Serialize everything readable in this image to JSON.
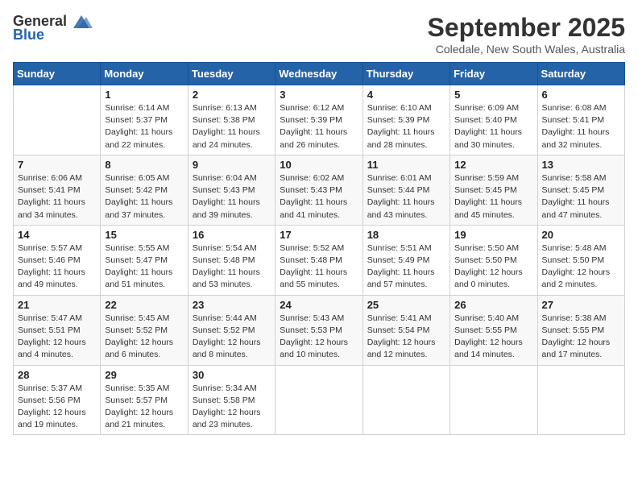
{
  "logo": {
    "general": "General",
    "blue": "Blue"
  },
  "title": "September 2025",
  "location": "Coledale, New South Wales, Australia",
  "weekdays": [
    "Sunday",
    "Monday",
    "Tuesday",
    "Wednesday",
    "Thursday",
    "Friday",
    "Saturday"
  ],
  "weeks": [
    [
      {
        "day": "",
        "info": ""
      },
      {
        "day": "1",
        "info": "Sunrise: 6:14 AM\nSunset: 5:37 PM\nDaylight: 11 hours\nand 22 minutes."
      },
      {
        "day": "2",
        "info": "Sunrise: 6:13 AM\nSunset: 5:38 PM\nDaylight: 11 hours\nand 24 minutes."
      },
      {
        "day": "3",
        "info": "Sunrise: 6:12 AM\nSunset: 5:39 PM\nDaylight: 11 hours\nand 26 minutes."
      },
      {
        "day": "4",
        "info": "Sunrise: 6:10 AM\nSunset: 5:39 PM\nDaylight: 11 hours\nand 28 minutes."
      },
      {
        "day": "5",
        "info": "Sunrise: 6:09 AM\nSunset: 5:40 PM\nDaylight: 11 hours\nand 30 minutes."
      },
      {
        "day": "6",
        "info": "Sunrise: 6:08 AM\nSunset: 5:41 PM\nDaylight: 11 hours\nand 32 minutes."
      }
    ],
    [
      {
        "day": "7",
        "info": "Sunrise: 6:06 AM\nSunset: 5:41 PM\nDaylight: 11 hours\nand 34 minutes."
      },
      {
        "day": "8",
        "info": "Sunrise: 6:05 AM\nSunset: 5:42 PM\nDaylight: 11 hours\nand 37 minutes."
      },
      {
        "day": "9",
        "info": "Sunrise: 6:04 AM\nSunset: 5:43 PM\nDaylight: 11 hours\nand 39 minutes."
      },
      {
        "day": "10",
        "info": "Sunrise: 6:02 AM\nSunset: 5:43 PM\nDaylight: 11 hours\nand 41 minutes."
      },
      {
        "day": "11",
        "info": "Sunrise: 6:01 AM\nSunset: 5:44 PM\nDaylight: 11 hours\nand 43 minutes."
      },
      {
        "day": "12",
        "info": "Sunrise: 5:59 AM\nSunset: 5:45 PM\nDaylight: 11 hours\nand 45 minutes."
      },
      {
        "day": "13",
        "info": "Sunrise: 5:58 AM\nSunset: 5:45 PM\nDaylight: 11 hours\nand 47 minutes."
      }
    ],
    [
      {
        "day": "14",
        "info": "Sunrise: 5:57 AM\nSunset: 5:46 PM\nDaylight: 11 hours\nand 49 minutes."
      },
      {
        "day": "15",
        "info": "Sunrise: 5:55 AM\nSunset: 5:47 PM\nDaylight: 11 hours\nand 51 minutes."
      },
      {
        "day": "16",
        "info": "Sunrise: 5:54 AM\nSunset: 5:48 PM\nDaylight: 11 hours\nand 53 minutes."
      },
      {
        "day": "17",
        "info": "Sunrise: 5:52 AM\nSunset: 5:48 PM\nDaylight: 11 hours\nand 55 minutes."
      },
      {
        "day": "18",
        "info": "Sunrise: 5:51 AM\nSunset: 5:49 PM\nDaylight: 11 hours\nand 57 minutes."
      },
      {
        "day": "19",
        "info": "Sunrise: 5:50 AM\nSunset: 5:50 PM\nDaylight: 12 hours\nand 0 minutes."
      },
      {
        "day": "20",
        "info": "Sunrise: 5:48 AM\nSunset: 5:50 PM\nDaylight: 12 hours\nand 2 minutes."
      }
    ],
    [
      {
        "day": "21",
        "info": "Sunrise: 5:47 AM\nSunset: 5:51 PM\nDaylight: 12 hours\nand 4 minutes."
      },
      {
        "day": "22",
        "info": "Sunrise: 5:45 AM\nSunset: 5:52 PM\nDaylight: 12 hours\nand 6 minutes."
      },
      {
        "day": "23",
        "info": "Sunrise: 5:44 AM\nSunset: 5:52 PM\nDaylight: 12 hours\nand 8 minutes."
      },
      {
        "day": "24",
        "info": "Sunrise: 5:43 AM\nSunset: 5:53 PM\nDaylight: 12 hours\nand 10 minutes."
      },
      {
        "day": "25",
        "info": "Sunrise: 5:41 AM\nSunset: 5:54 PM\nDaylight: 12 hours\nand 12 minutes."
      },
      {
        "day": "26",
        "info": "Sunrise: 5:40 AM\nSunset: 5:55 PM\nDaylight: 12 hours\nand 14 minutes."
      },
      {
        "day": "27",
        "info": "Sunrise: 5:38 AM\nSunset: 5:55 PM\nDaylight: 12 hours\nand 17 minutes."
      }
    ],
    [
      {
        "day": "28",
        "info": "Sunrise: 5:37 AM\nSunset: 5:56 PM\nDaylight: 12 hours\nand 19 minutes."
      },
      {
        "day": "29",
        "info": "Sunrise: 5:35 AM\nSunset: 5:57 PM\nDaylight: 12 hours\nand 21 minutes."
      },
      {
        "day": "30",
        "info": "Sunrise: 5:34 AM\nSunset: 5:58 PM\nDaylight: 12 hours\nand 23 minutes."
      },
      {
        "day": "",
        "info": ""
      },
      {
        "day": "",
        "info": ""
      },
      {
        "day": "",
        "info": ""
      },
      {
        "day": "",
        "info": ""
      }
    ]
  ]
}
